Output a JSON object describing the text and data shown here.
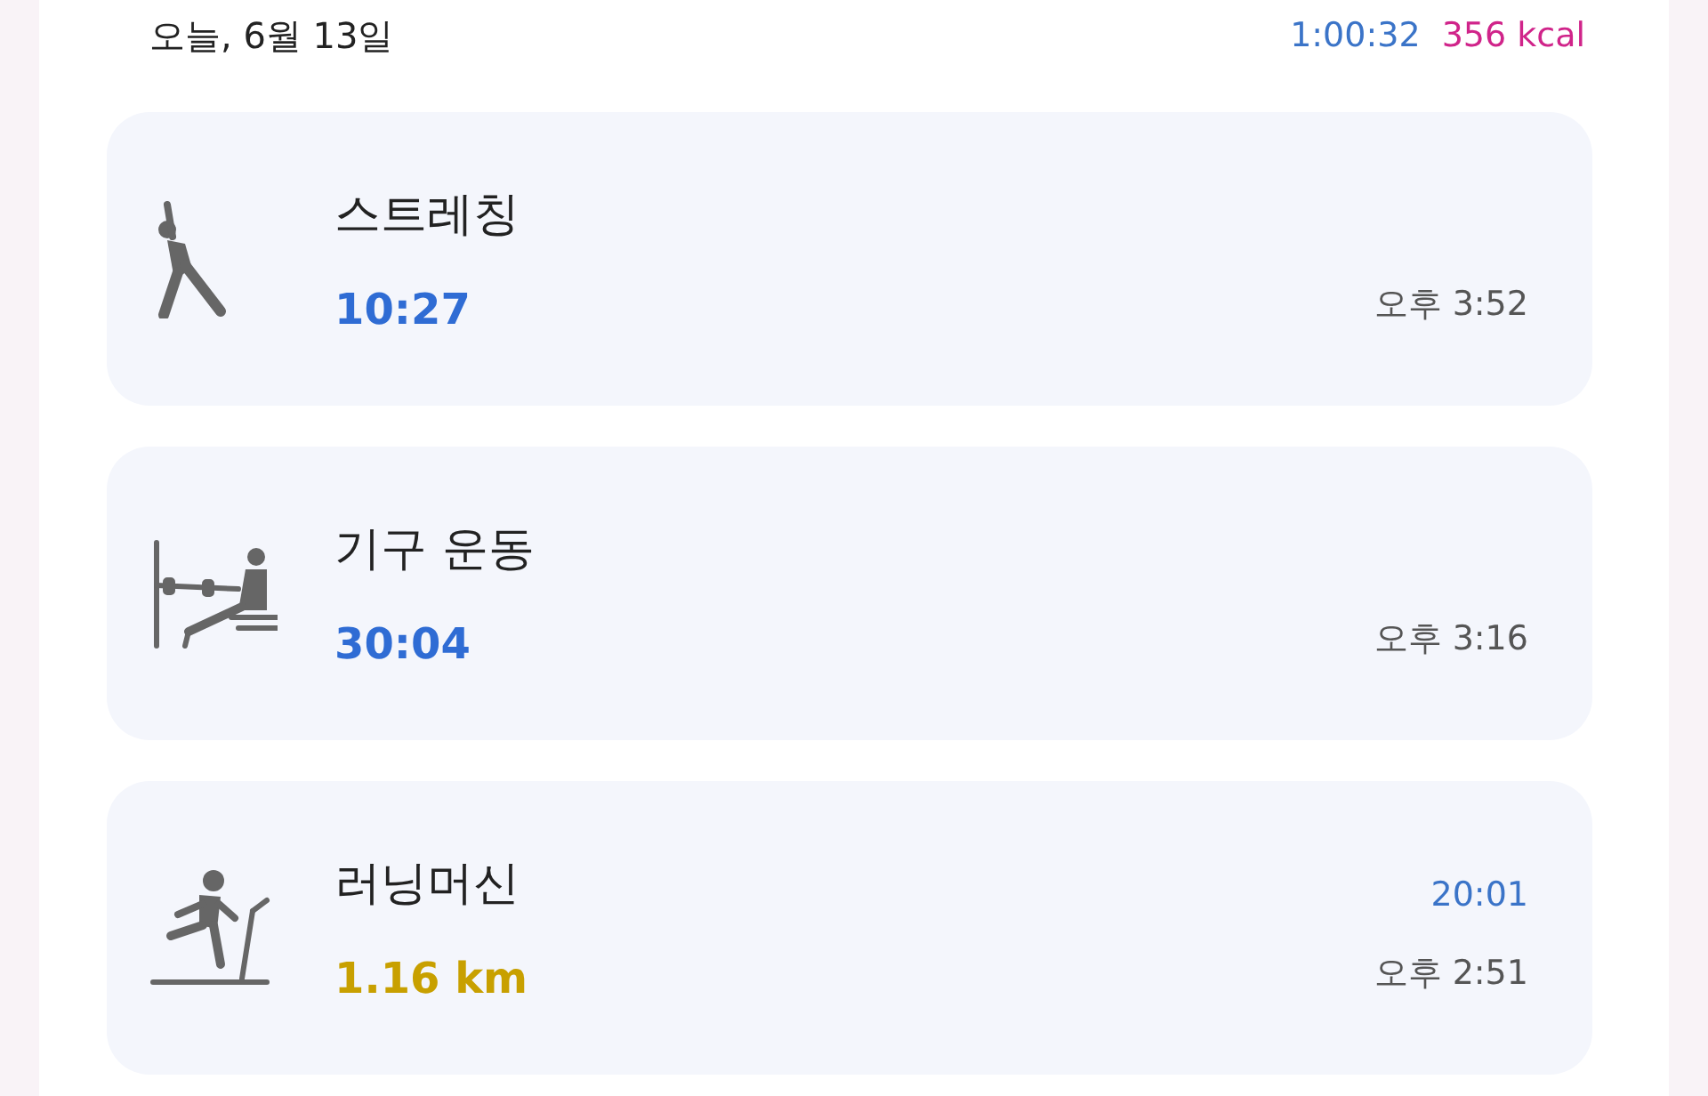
{
  "header": {
    "date": "오늘, 6월 13일",
    "duration": "1:00:32",
    "calories": "356 kcal"
  },
  "workouts": [
    {
      "kind": "stretch",
      "name": "스트레칭",
      "stat": "10:27",
      "color": "#2f6cd4",
      "time": "오후 3:52"
    },
    {
      "kind": "machine",
      "name": "기구 운동",
      "stat": "30:04",
      "color": "#2f6cd4",
      "time": "오후 3:16"
    },
    {
      "kind": "treadmill",
      "name": "러닝머신",
      "duration": "20:01",
      "stat": "1.16 km",
      "color": "#c8a000",
      "time": "오후 2:51"
    }
  ]
}
